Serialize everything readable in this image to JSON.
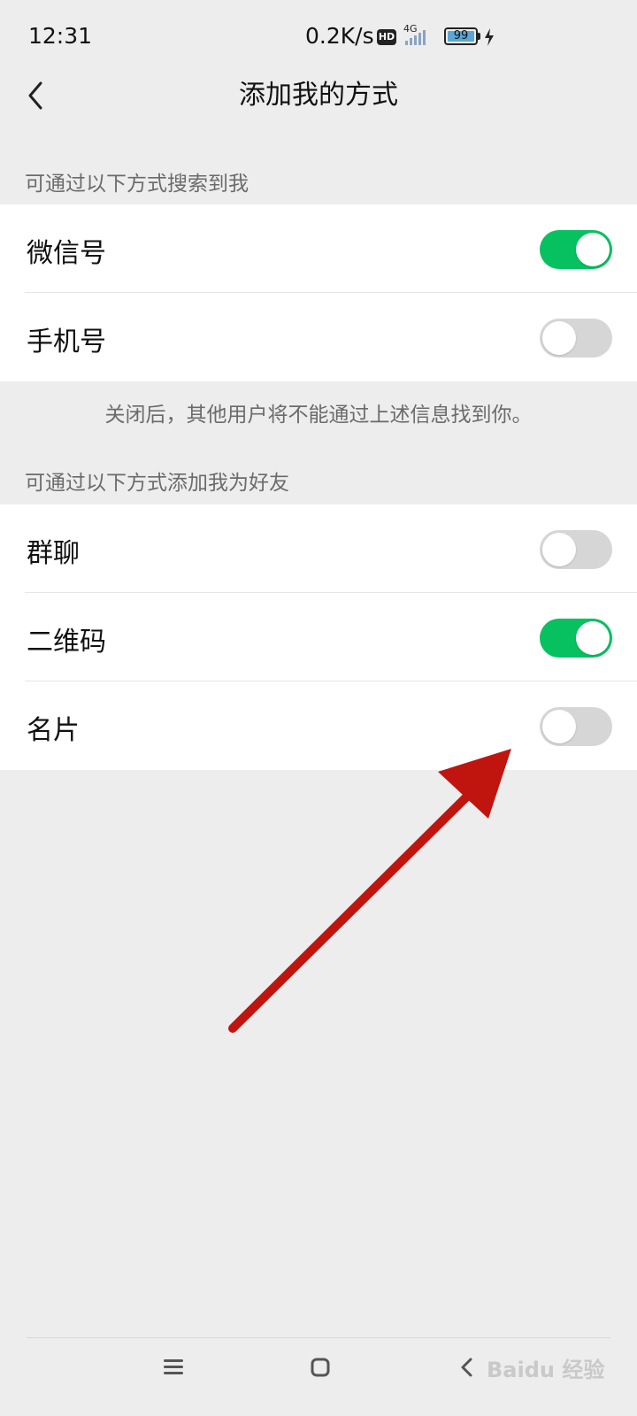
{
  "status_bar": {
    "time": "12:31",
    "net_speed": "0.2K/s",
    "hd_badge": "HD",
    "network_type": "4G",
    "battery_level": "99",
    "icons": [
      "hd-badge-icon",
      "signal-icon",
      "battery-icon",
      "charging-bolt-icon"
    ]
  },
  "header": {
    "title": "添加我的方式",
    "back_icon": "chevron-left-icon"
  },
  "search_section": {
    "header": "可通过以下方式搜索到我",
    "items": [
      {
        "label": "微信号",
        "enabled": true
      },
      {
        "label": "手机号",
        "enabled": false
      }
    ],
    "hint": "关闭后，其他用户将不能通过上述信息找到你。"
  },
  "add_section": {
    "header": "可通过以下方式添加我为好友",
    "items": [
      {
        "label": "群聊",
        "enabled": false
      },
      {
        "label": "二维码",
        "enabled": true
      },
      {
        "label": "名片",
        "enabled": false
      }
    ]
  },
  "system_nav": {
    "icons": [
      "menu-icon",
      "home-icon",
      "back-icon"
    ]
  },
  "watermark": "Baidu 经验",
  "colors": {
    "toggle_on": "#07c160",
    "toggle_off": "#d6d6d6",
    "background": "#ededed",
    "annotation_arrow": "#c0150f"
  }
}
